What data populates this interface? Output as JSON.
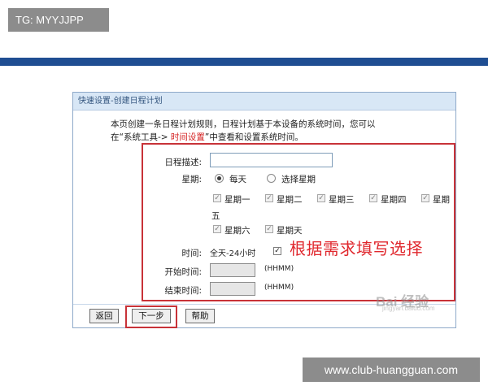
{
  "tag_label": "TG: MYYJJPP",
  "site_label": "www.club-huangguan.com",
  "colors": {
    "top_band": "#1f4e92",
    "highlight_red": "#c83238",
    "title_bar": "#d8e7f6"
  },
  "dialog": {
    "title": "快速设置-创建日程计划",
    "intro_line1": "本页创建一条日程计划规则，日程计划基于本设备的系统时间，您可以",
    "intro_line2_prefix": "在“系统工具-> ",
    "intro_line2_link": "时间设置",
    "intro_line2_suffix": "”中查看和设置系统时间。",
    "desc_label": "日程描述:",
    "desc_value": "",
    "week_label": "星期:",
    "radio_everyday": "每天",
    "radio_select": "选择星期",
    "days": [
      "星期一",
      "星期二",
      "星期三",
      "星期四",
      "星期",
      "五",
      "星期六",
      "星期天"
    ],
    "time_label": "时间:",
    "allday_label": "全天-24小时",
    "start_label": "开始时间:",
    "end_label": "结束时间:",
    "hhmm_hint": "(HHMM)",
    "annotation": "根据需求填写选择",
    "buttons": {
      "back": "返回",
      "next": "下一步",
      "help": "帮助"
    }
  },
  "watermark": {
    "main": "Bai 经验",
    "sub": "jingyan.baidu.com"
  }
}
